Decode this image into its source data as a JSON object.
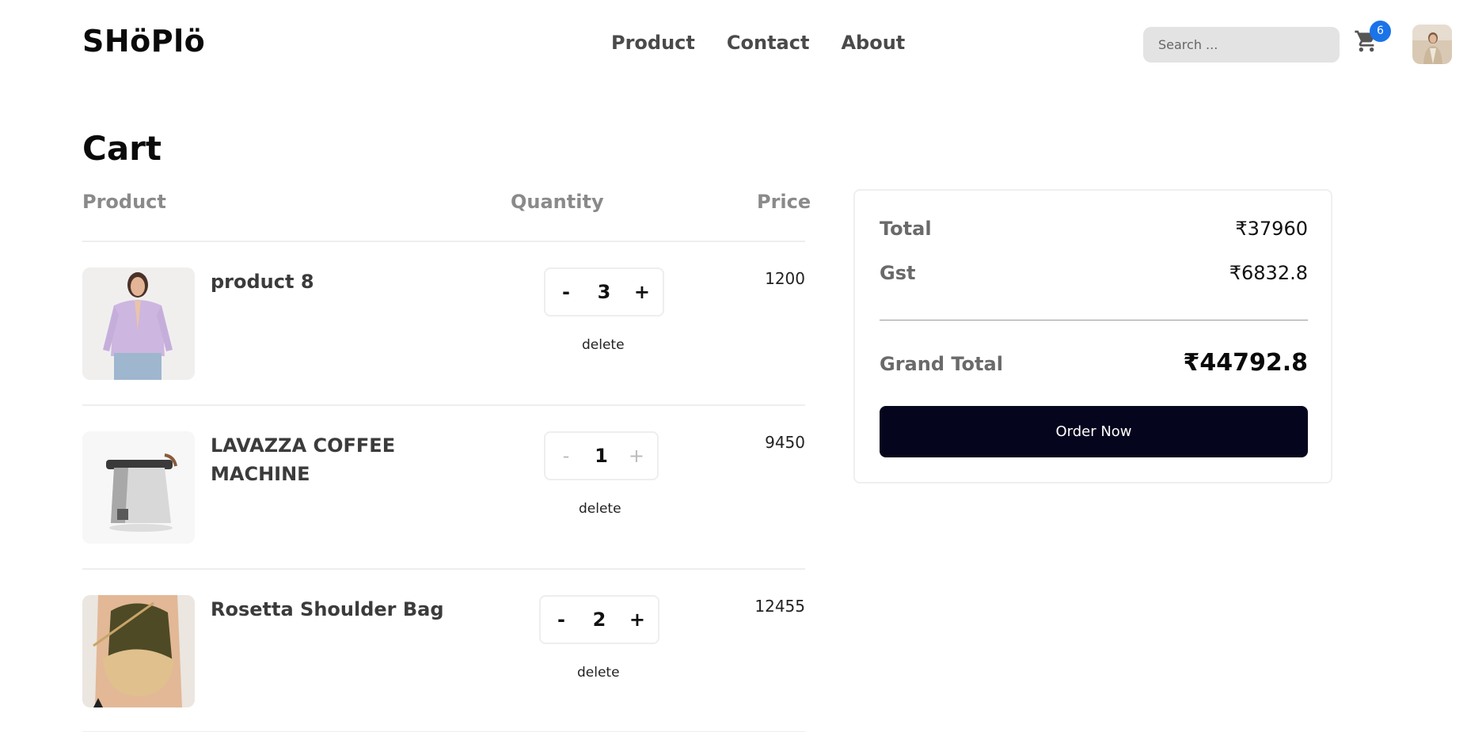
{
  "header": {
    "logo": "SHöPlö",
    "nav": [
      "Product",
      "Contact",
      "About"
    ],
    "search_placeholder": "Search ...",
    "cart_count": "6"
  },
  "cart": {
    "title": "Cart",
    "columns": {
      "product": "Product",
      "quantity": "Quantity",
      "price": "Price"
    },
    "delete_label": "delete",
    "items": [
      {
        "name": "product 8",
        "quantity": "3",
        "price": "1200",
        "image": "woman-lilac-cardigan"
      },
      {
        "name": "LAVAZZA COFFEE MACHINE",
        "quantity": "1",
        "price": "9450",
        "image": "coffee-machine"
      },
      {
        "name": "Rosetta Shoulder Bag",
        "quantity": "2",
        "price": "12455",
        "image": "shoulder-bag"
      }
    ]
  },
  "summary": {
    "total_label": "Total",
    "total_value": "₹37960",
    "gst_label": "Gst",
    "gst_value": "₹6832.8",
    "grand_label": "Grand Total",
    "grand_value": "₹44792.8",
    "order_label": "Order Now"
  },
  "colors": {
    "accent": "#05051e",
    "badge": "#1a73e8",
    "muted_text": "#8a8a8a"
  }
}
